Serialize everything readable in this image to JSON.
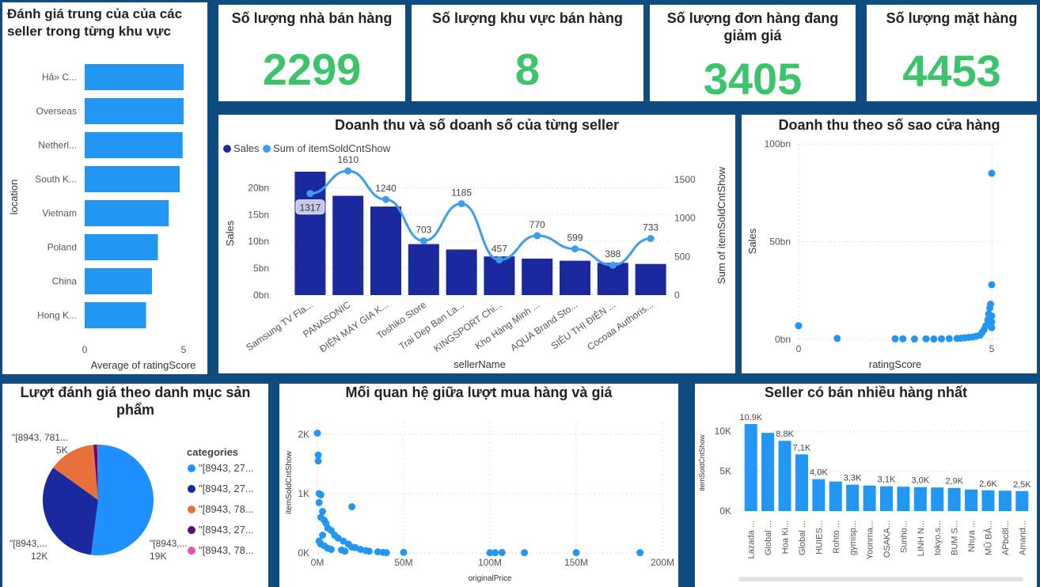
{
  "colors": {
    "bar": "#2196f3",
    "dark_bar": "#1a2a9e",
    "line": "#3d9cf0",
    "kpi": "#3cc46b",
    "pie": [
      "#1e90ff",
      "#1a2a9e",
      "#e8703a",
      "#5a0f6e",
      "#e94fb0"
    ]
  },
  "kpis": [
    {
      "title": "Số lượng nhà bán hàng",
      "value": "2299"
    },
    {
      "title": "Số lượng khu vực bán hàng",
      "value": "8"
    },
    {
      "title": "Số lượng đơn hàng đang giảm giá",
      "value": "3405"
    },
    {
      "title": "Số lượng mặt hàng",
      "value": "4453"
    }
  ],
  "chart_data": [
    {
      "type": "bar",
      "orientation": "horizontal",
      "title": "Đánh giá trung của của các seller trong từng khu vực",
      "xlabel": "Average of ratingScore",
      "ylabel": "location",
      "categories": [
        "Hả» C...",
        "Overseas",
        "Netherl...",
        "South K...",
        "Vietnam",
        "Poland",
        "China",
        "Hong K..."
      ],
      "values": [
        5.0,
        5.0,
        4.95,
        4.8,
        4.25,
        3.7,
        3.4,
        3.1
      ],
      "xlim": [
        0,
        5
      ],
      "xticks": [
        "0",
        "5"
      ]
    },
    {
      "type": "bar",
      "title": "Doanh thu và số doanh số của từng seller",
      "xlabel": "sellerName",
      "ylabel": "Sales",
      "y2label": "Sum of itemSoldCntShow",
      "legend": [
        "Sales",
        "Sum of itemSoldCntShow"
      ],
      "categories": [
        "Samsung TV Fla...",
        "PANASONIC",
        "ĐIỆN MÁY GIA K...",
        "Toshiko Store",
        "Trai Dep Ban La...",
        "KINGSPORT Chi...",
        "Kho Hàng Minh ...",
        "AQUA Brand Sto...",
        "SIÊU THỊ ĐIỆN ...",
        "Cocoaa Authoris..."
      ],
      "series": [
        {
          "name": "Sales",
          "values": [
            23,
            18.5,
            16.5,
            9.5,
            8.5,
            7.2,
            6.8,
            6.4,
            6.0,
            5.8
          ]
        },
        {
          "name": "Sum of itemSoldCntShow",
          "values": [
            1317,
            1610,
            1240,
            703,
            1185,
            457,
            770,
            599,
            388,
            733
          ]
        }
      ],
      "ylim": [
        0,
        23
      ],
      "y2lim": [
        0,
        1600
      ],
      "yticks": [
        "0bn",
        "5bn",
        "10bn",
        "15bn",
        "20bn"
      ],
      "y2ticks": [
        "0",
        "500",
        "1000",
        "1500"
      ],
      "data_labels": [
        "1317",
        "1610",
        "1240",
        "703",
        "1185",
        "457",
        "770",
        "599",
        "388",
        "733"
      ]
    },
    {
      "type": "scatter",
      "title": "Doanh thu theo số sao cửa hàng",
      "xlabel": "ratingScore",
      "ylabel": "Sales",
      "xlim": [
        0,
        5
      ],
      "ylim": [
        0,
        100
      ],
      "xticks": [
        "0",
        "5"
      ],
      "yticks": [
        "0bn",
        "50bn",
        "100bn"
      ],
      "points": [
        [
          0,
          7
        ],
        [
          1,
          0.5
        ],
        [
          2.5,
          0.3
        ],
        [
          2.7,
          0.3
        ],
        [
          3,
          0.2
        ],
        [
          3.3,
          0.3
        ],
        [
          3.5,
          0.2
        ],
        [
          3.7,
          0.3
        ],
        [
          3.9,
          0.4
        ],
        [
          4.1,
          0.5
        ],
        [
          4.2,
          0.6
        ],
        [
          4.3,
          0.8
        ],
        [
          4.4,
          1.0
        ],
        [
          4.5,
          1.2
        ],
        [
          4.6,
          1.6
        ],
        [
          4.7,
          2.2
        ],
        [
          4.75,
          3.5
        ],
        [
          4.8,
          5
        ],
        [
          4.85,
          7
        ],
        [
          4.9,
          10
        ],
        [
          4.92,
          13
        ],
        [
          4.95,
          16
        ],
        [
          4.97,
          18
        ],
        [
          5,
          28
        ],
        [
          5,
          85
        ],
        [
          5,
          12
        ],
        [
          5,
          9
        ],
        [
          5,
          6
        ]
      ]
    },
    {
      "type": "pie",
      "title": "Lượt đánh giá theo danh mục sản phẩm",
      "legend_title": "categories",
      "legend": [
        "\"[8943, 27...",
        "\"[8943, 27...",
        "\"[8943, 78...",
        "\"[8943, 27...",
        "\"[8943, 78..."
      ],
      "values": [
        19,
        12,
        5,
        0.4,
        0.1
      ],
      "slice_labels": [
        {
          "name": "\"[8943,...",
          "value": "19K"
        },
        {
          "name": "\"[8943,...",
          "value": "12K"
        },
        {
          "name": "\"[8943, 781...",
          "value": "5K"
        }
      ]
    },
    {
      "type": "scatter",
      "title": "Mối quan hệ giữa lượt mua hàng và giá",
      "xlabel": "originalPrice",
      "ylabel": "itemSoldCntShow",
      "xlim": [
        0,
        200
      ],
      "ylim": [
        0,
        2200
      ],
      "xticks": [
        "0M",
        "50M",
        "100M",
        "150M",
        "200M"
      ],
      "yticks": [
        "0K",
        "1K",
        "2K"
      ],
      "points": [
        [
          0,
          2020
        ],
        [
          0.5,
          1650
        ],
        [
          0.5,
          1550
        ],
        [
          1,
          1000
        ],
        [
          2,
          980
        ],
        [
          1,
          850
        ],
        [
          3,
          700
        ],
        [
          2,
          600
        ],
        [
          4,
          550
        ],
        [
          5,
          500
        ],
        [
          6,
          420
        ],
        [
          8,
          380
        ],
        [
          3,
          300
        ],
        [
          10,
          300
        ],
        [
          12,
          250
        ],
        [
          15,
          200
        ],
        [
          18,
          150
        ],
        [
          20,
          780
        ],
        [
          20,
          100
        ],
        [
          22,
          90
        ],
        [
          25,
          60
        ],
        [
          28,
          40
        ],
        [
          30,
          30
        ],
        [
          35,
          20
        ],
        [
          38,
          10
        ],
        [
          40,
          5
        ],
        [
          50,
          10
        ],
        [
          100,
          5
        ],
        [
          103,
          5
        ],
        [
          107,
          8
        ],
        [
          120,
          5
        ],
        [
          150,
          5
        ],
        [
          187,
          5
        ],
        [
          1,
          200
        ],
        [
          2,
          150
        ],
        [
          4,
          120
        ],
        [
          6,
          80
        ],
        [
          8,
          60
        ],
        [
          14,
          50
        ],
        [
          16,
          30
        ]
      ]
    },
    {
      "type": "bar",
      "title": "Seller có bán nhiều hàng nhất",
      "ylabel": "itemSoldCntShow",
      "categories": [
        "Lazada ...",
        "Global ...",
        "Hoa Ki...",
        "Global ...",
        "HUIES...",
        "Rohto ...",
        "gymisp...",
        "Yoonma...",
        "OSAKA...",
        "Sunho...",
        "LINH N...",
        "tokyo.s...",
        "BUM S...",
        "Nhựa ...",
        "MŨ BẢ...",
        "APbc8l...",
        "Amand..."
      ],
      "values": [
        10.9,
        9.8,
        8.8,
        7.1,
        4.0,
        3.7,
        3.3,
        3.2,
        3.1,
        3.05,
        3.0,
        2.95,
        2.9,
        2.7,
        2.6,
        2.55,
        2.5
      ],
      "data_labels": [
        "10,9K",
        "",
        "8,8K",
        "7,1K",
        "4,0K",
        "",
        "3,3K",
        "",
        "3,1K",
        "",
        "3,0K",
        "",
        "2,9K",
        "",
        "2,6K",
        "",
        "2,5K"
      ],
      "ylim": [
        0,
        11.5
      ],
      "yticks": [
        "0K",
        "5K",
        "10K"
      ]
    }
  ]
}
